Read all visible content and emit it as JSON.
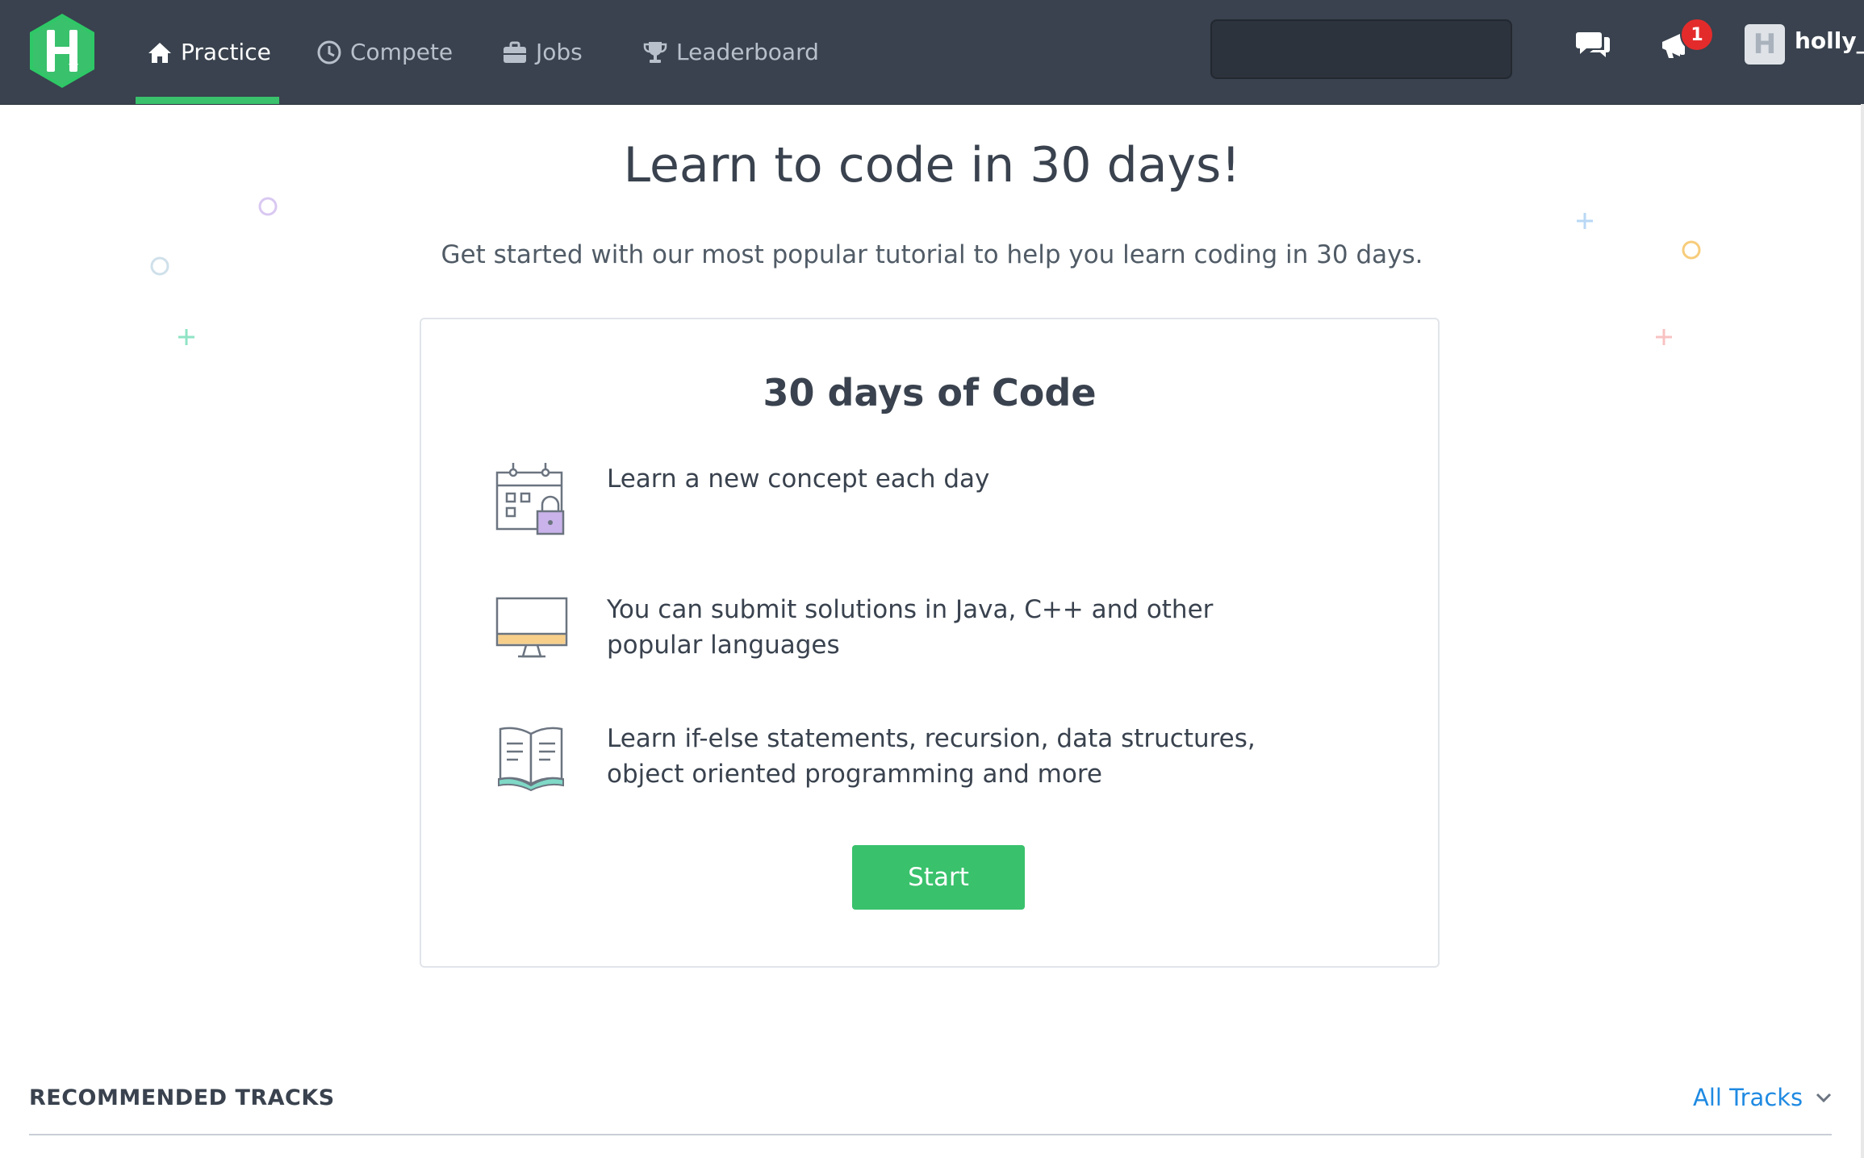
{
  "nav": {
    "logo_icon": "hackerrank-logo-icon",
    "items": [
      {
        "label": "Practice",
        "icon": "home-icon",
        "active": true
      },
      {
        "label": "Compete",
        "icon": "clock-icon",
        "active": false
      },
      {
        "label": "Jobs",
        "icon": "briefcase-icon",
        "active": false
      },
      {
        "label": "Leaderboard",
        "icon": "trophy-icon",
        "active": false
      }
    ],
    "search_placeholder": "",
    "notification_count": "1",
    "username": "holly_v",
    "avatar_letter": "H"
  },
  "hero": {
    "title": "Learn to code in 30 days!",
    "subtitle": "Get started with our most popular tutorial to help you learn coding in 30 days."
  },
  "card": {
    "title": "30 days of Code",
    "features": [
      {
        "icon": "calendar-lock-icon",
        "text": "Learn a new concept each day"
      },
      {
        "icon": "monitor-icon",
        "text": "You can submit solutions in Java, C++ and other popular languages"
      },
      {
        "icon": "open-book-icon",
        "text": "Learn if-else statements, recursion, data structures, object oriented programming and more"
      }
    ],
    "start_label": "Start"
  },
  "recommended": {
    "title": "RECOMMENDED TRACKS",
    "all_tracks_label": "All Tracks"
  },
  "colors": {
    "topbar": "#39424e",
    "accent_green": "#39c16c",
    "link_blue": "#1f8ae2",
    "badge_red": "#e42b2b"
  }
}
